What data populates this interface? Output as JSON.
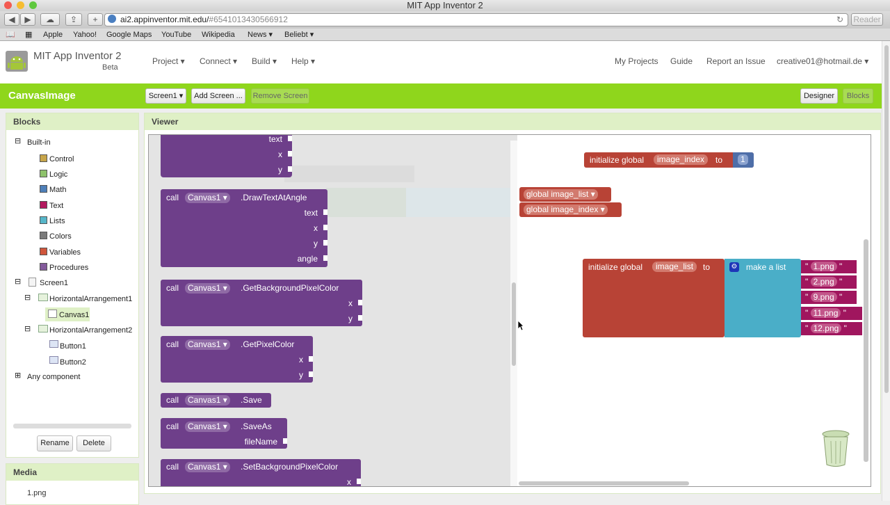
{
  "browser": {
    "window_title": "MIT App Inventor 2",
    "url_host": "ai2.appinventor.mit.edu/",
    "url_hash": "#6541013430566912",
    "reader": "Reader",
    "bookmarks": [
      "Apple",
      "Yahoo!",
      "Google Maps",
      "YouTube",
      "Wikipedia",
      "News ▾",
      "Beliebt ▾"
    ]
  },
  "app": {
    "title": "MIT App Inventor 2",
    "subtitle": "Beta",
    "menu": [
      "Project ▾",
      "Connect ▾",
      "Build ▾",
      "Help ▾"
    ],
    "right_menu": [
      "My Projects",
      "Guide",
      "Report an Issue",
      "creative01@hotmail.de ▾"
    ]
  },
  "project": {
    "name": "CanvasImage",
    "screen_button": "Screen1 ▾",
    "add_screen": "Add Screen ...",
    "remove_screen": "Remove Screen",
    "designer": "Designer",
    "blocks": "Blocks"
  },
  "blocks_panel": {
    "title": "Blocks",
    "builtin": "Built-in",
    "builtin_items": [
      {
        "label": "Control",
        "color": "#c7a54a"
      },
      {
        "label": "Logic",
        "color": "#8ec26b"
      },
      {
        "label": "Math",
        "color": "#4e7fb8"
      },
      {
        "label": "Text",
        "color": "#b3195e"
      },
      {
        "label": "Lists",
        "color": "#56b6c9"
      },
      {
        "label": "Colors",
        "color": "#7a7a7a"
      },
      {
        "label": "Variables",
        "color": "#d0563c"
      },
      {
        "label": "Procedures",
        "color": "#835a9b"
      }
    ],
    "screen": "Screen1",
    "ha1": "HorizontalArrangement1",
    "canvas": "Canvas1",
    "ha2": "HorizontalArrangement2",
    "button1": "Button1",
    "button2": "Button2",
    "any": "Any component",
    "rename": "Rename",
    "delete": "Delete"
  },
  "media": {
    "title": "Media",
    "file": "1.png"
  },
  "viewer": {
    "title": "Viewer",
    "flyout": {
      "top_params": [
        "text",
        "x",
        "y"
      ],
      "call": "call",
      "component": "Canvas1",
      "draw_text": ".DrawTextAtAngle",
      "draw_text_params": [
        "text",
        "x",
        "y",
        "angle"
      ],
      "get_bg": ".GetBackgroundPixelColor",
      "get_bg_params": [
        "x",
        "y"
      ],
      "get_pixel": ".GetPixelColor",
      "get_pixel_params": [
        "x",
        "y"
      ],
      "save": ".Save",
      "save_as": ".SaveAs",
      "save_as_param": "fileName",
      "set_bg": ".SetBackgroundPixelColor",
      "set_bg_param": "x"
    },
    "workspace": {
      "init_index": "initialize global",
      "index_name": "image_index",
      "to": "to",
      "index_value": "1",
      "get_list": "global image_list",
      "get_index": "global image_index",
      "init_list": "initialize global",
      "list_name": "image_list",
      "make_list": "make a list",
      "items": [
        "1.png",
        "2.png",
        "9.png",
        "11.png",
        "12.png"
      ]
    }
  }
}
